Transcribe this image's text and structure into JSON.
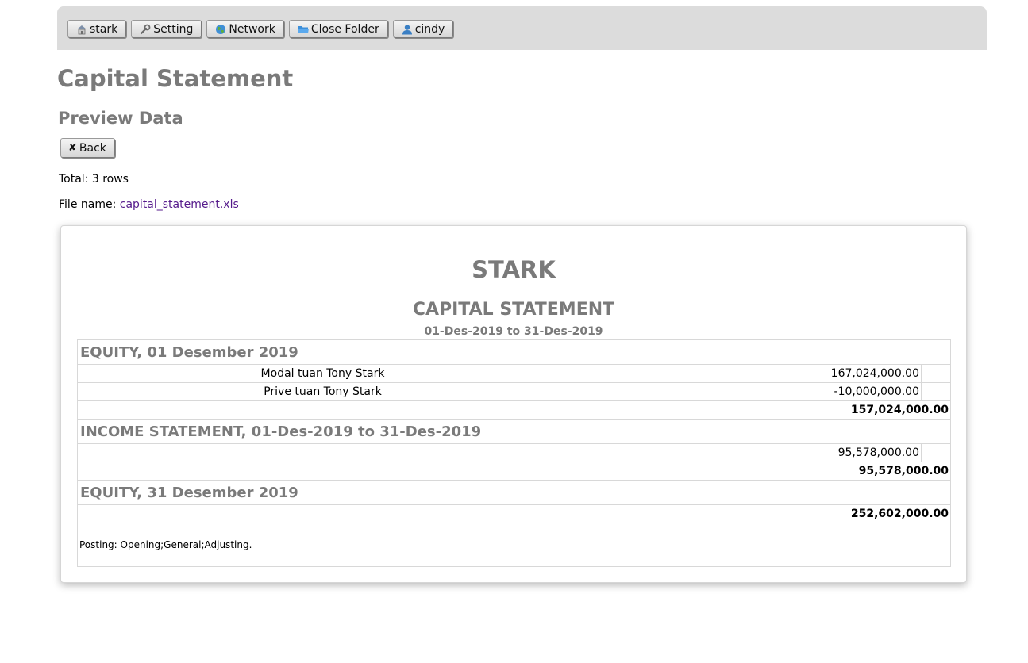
{
  "toolbar": {
    "buttons": [
      {
        "label": "stark",
        "icon": "home-icon"
      },
      {
        "label": "Setting",
        "icon": "wrench-icon"
      },
      {
        "label": "Network",
        "icon": "globe-icon"
      },
      {
        "label": "Close Folder",
        "icon": "folder-icon"
      },
      {
        "label": "cindy",
        "icon": "user-icon"
      }
    ]
  },
  "page": {
    "title": "Capital Statement",
    "subtitle": "Preview Data",
    "back_label": "Back",
    "total_text": "Total: 3 rows",
    "file_label": "File name: ",
    "file_link": "capital_statement.xls"
  },
  "report": {
    "company": "STARK",
    "title": "CAPITAL STATEMENT",
    "period": "01-Des-2019 to 31-Des-2019",
    "sections": {
      "opening": {
        "heading": "EQUITY, 01 Desember 2019",
        "rows": [
          {
            "name": "Modal tuan Tony Stark",
            "amount": "167,024,000.00"
          },
          {
            "name": "Prive tuan Tony Stark",
            "amount": "-10,000,000.00"
          }
        ],
        "total": "157,024,000.00"
      },
      "income": {
        "heading": "INCOME STATEMENT, 01-Des-2019 to 31-Des-2019",
        "rows": [
          {
            "name": "",
            "amount": "95,578,000.00"
          }
        ],
        "total": "95,578,000.00"
      },
      "closing": {
        "heading": "EQUITY, 31 Desember 2019",
        "total": "252,602,000.00"
      }
    },
    "posting": "Posting: Opening;General;Adjusting."
  },
  "colors": {
    "toolbar_bg": "#dcdcdc",
    "heading_gray": "#7a7a7a",
    "link": "#551a8b"
  }
}
